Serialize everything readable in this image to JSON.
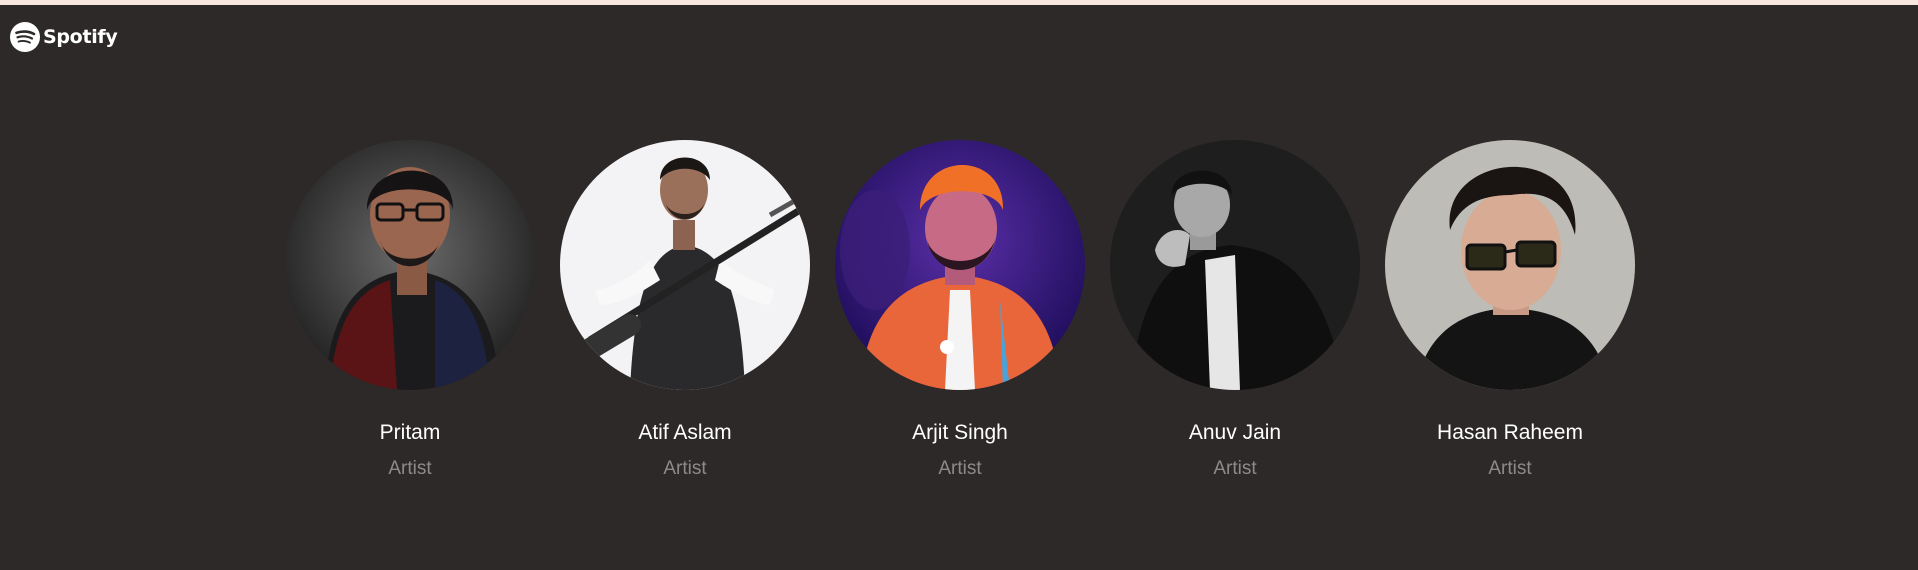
{
  "brand": {
    "name": "Spotify",
    "icon": "spotify-logo-icon"
  },
  "artists": [
    {
      "name": "Pritam",
      "role": "Artist"
    },
    {
      "name": "Atif Aslam",
      "role": "Artist"
    },
    {
      "name": "Arjit Singh",
      "role": "Artist"
    },
    {
      "name": "Anuv Jain",
      "role": "Artist"
    },
    {
      "name": "Hasan Raheem",
      "role": "Artist"
    }
  ],
  "colors": {
    "background": "#2d2928",
    "top_strip": "#f6e6e0",
    "name_text": "#ffffff",
    "role_text": "#8e8a89"
  }
}
